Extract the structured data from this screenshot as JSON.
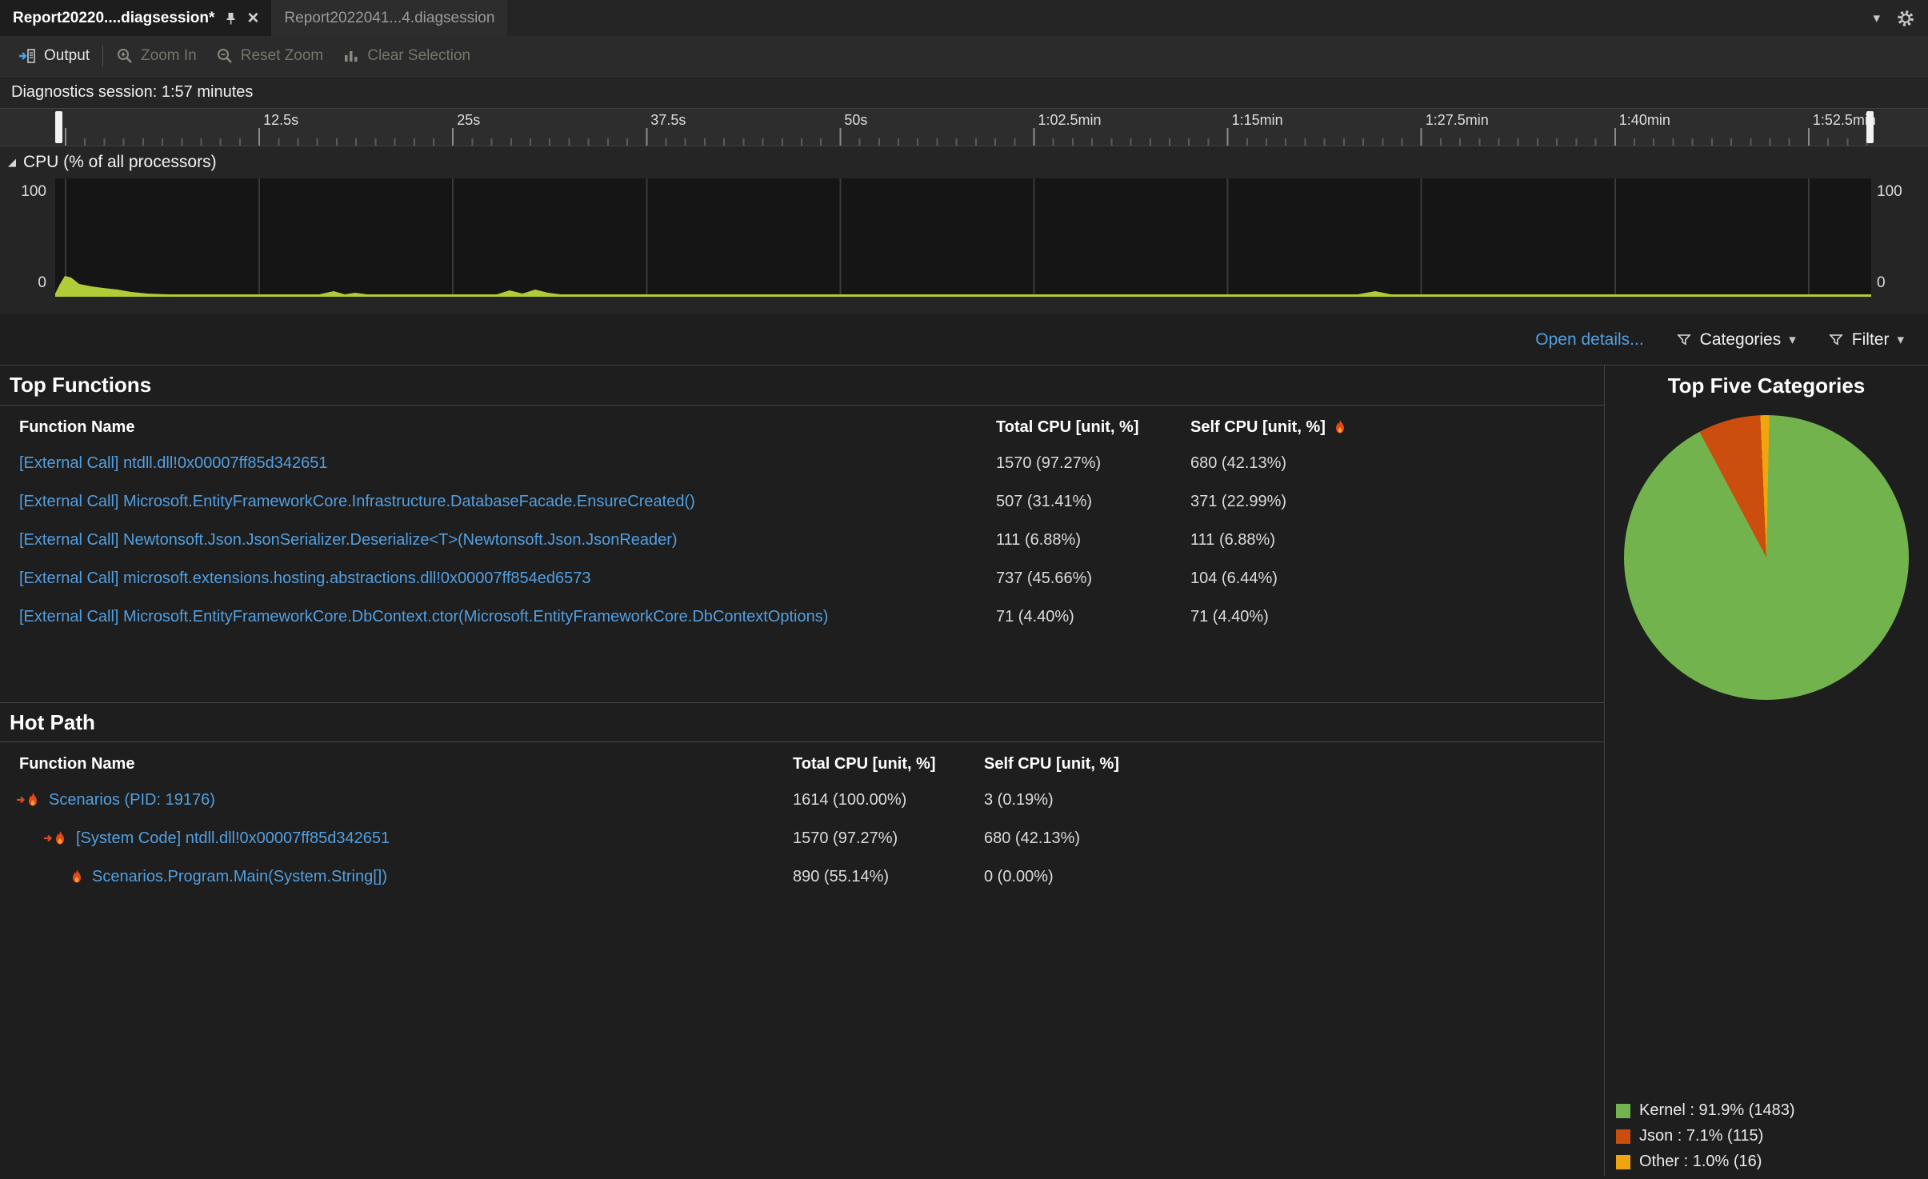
{
  "tabs": {
    "active": {
      "title": "Report20220....diagsession*"
    },
    "inactive": {
      "title": "Report2022041...4.diagsession"
    }
  },
  "toolbar": {
    "output_label": "Output",
    "zoom_in_label": "Zoom In",
    "reset_zoom_label": "Reset Zoom",
    "clear_selection_label": "Clear Selection"
  },
  "session": {
    "label": "Diagnostics session: 1:57 minutes"
  },
  "timeline": {
    "ticks": [
      "12.5s",
      "25s",
      "37.5s",
      "50s",
      "1:02.5min",
      "1:15min",
      "1:27.5min",
      "1:40min",
      "1:52.5min"
    ]
  },
  "cpu_chart": {
    "title": "CPU (% of all processors)",
    "y_max": "100",
    "y_min": "0",
    "color": "#b0cc38",
    "spark": [
      [
        0,
        4
      ],
      [
        6,
        16
      ],
      [
        12,
        26
      ],
      [
        20,
        24
      ],
      [
        30,
        16
      ],
      [
        45,
        13
      ],
      [
        60,
        11
      ],
      [
        78,
        9
      ],
      [
        95,
        6
      ],
      [
        115,
        4
      ],
      [
        140,
        3
      ],
      [
        330,
        3
      ],
      [
        348,
        7
      ],
      [
        362,
        3
      ],
      [
        375,
        5
      ],
      [
        390,
        3
      ],
      [
        552,
        3
      ],
      [
        568,
        8
      ],
      [
        584,
        4
      ],
      [
        600,
        9
      ],
      [
        616,
        5
      ],
      [
        632,
        3
      ],
      [
        1628,
        3
      ],
      [
        1650,
        7
      ],
      [
        1670,
        3
      ],
      [
        2270,
        3
      ]
    ]
  },
  "controls": {
    "open_details_label": "Open details...",
    "categories_label": "Categories",
    "filter_label": "Filter"
  },
  "top_functions": {
    "title": "Top Functions",
    "columns": [
      "Function Name",
      "Total CPU [unit, %]",
      "Self CPU [unit, %]"
    ],
    "rows": [
      {
        "name": "[External Call] ntdll.dll!0x00007ff85d342651",
        "total": "1570 (97.27%)",
        "self": "680 (42.13%)"
      },
      {
        "name": "[External Call] Microsoft.EntityFrameworkCore.Infrastructure.DatabaseFacade.EnsureCreated()",
        "total": "507 (31.41%)",
        "self": "371 (22.99%)"
      },
      {
        "name": "[External Call] Newtonsoft.Json.JsonSerializer.Deserialize<T>(Newtonsoft.Json.JsonReader)",
        "total": "111 (6.88%)",
        "self": "111 (6.88%)"
      },
      {
        "name": "[External Call] microsoft.extensions.hosting.abstractions.dll!0x00007ff854ed6573",
        "total": "737 (45.66%)",
        "self": "104 (6.44%)"
      },
      {
        "name": "[External Call] Microsoft.EntityFrameworkCore.DbContext.ctor(Microsoft.EntityFrameworkCore.DbContextOptions)",
        "total": "71 (4.40%)",
        "self": "71 (4.40%)"
      }
    ]
  },
  "hot_path": {
    "title": "Hot Path",
    "columns": [
      "Function Name",
      "Total CPU [unit, %]",
      "Self CPU [unit, %]"
    ],
    "rows": [
      {
        "name": "Scenarios (PID: 19176)",
        "total": "1614 (100.00%)",
        "self": "3 (0.19%)"
      },
      {
        "name": "[System Code] ntdll.dll!0x00007ff85d342651",
        "total": "1570 (97.27%)",
        "self": "680 (42.13%)"
      },
      {
        "name": "Scenarios.Program.Main(System.String[])",
        "total": "890 (55.14%)",
        "self": "0 (0.00%)"
      }
    ]
  },
  "categories_panel": {
    "title": "Top Five Categories",
    "chart_data": {
      "type": "pie",
      "start_angle": 332,
      "slices": [
        {
          "label": "Json",
          "pct": 7.1,
          "count": 115,
          "color": "#cb4e0e"
        },
        {
          "label": "Other",
          "pct": 1.0,
          "count": 16,
          "color": "#efa50e"
        },
        {
          "label": "Kernel",
          "pct": 91.9,
          "count": 1483,
          "color": "#72b34e"
        }
      ]
    },
    "legend": [
      {
        "label": "Kernel : 91.9% (1483)",
        "color": "#72b34e"
      },
      {
        "label": "Json : 7.1% (115)",
        "color": "#cb4e0e"
      },
      {
        "label": "Other : 1.0% (16)",
        "color": "#efa50e"
      }
    ]
  }
}
